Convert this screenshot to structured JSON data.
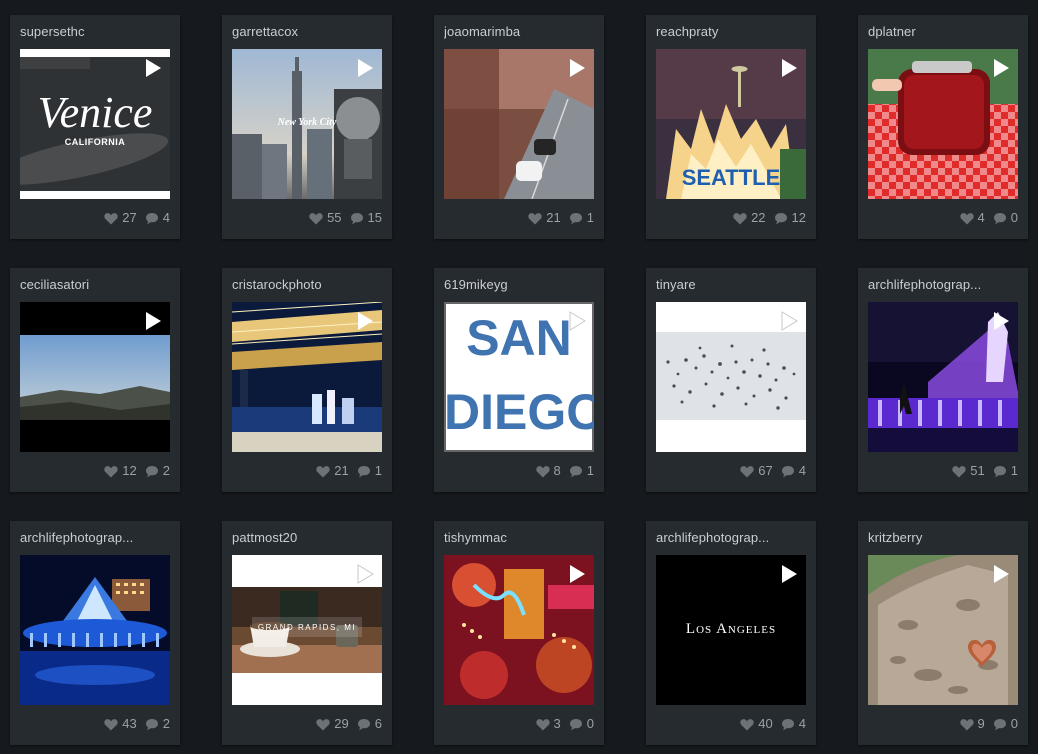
{
  "colors": {
    "background": "#16191d",
    "card": "#262b30",
    "username": "#c9ced3",
    "stats": "#9aa0a6"
  },
  "icons": {
    "play": "play-icon",
    "like": "heart-icon",
    "comment": "comment-icon"
  },
  "posts": [
    {
      "username": "supersethc",
      "likes": "27",
      "comments": "4",
      "thumb_title": "Venice",
      "thumb_subtitle": "CALIFORNIA"
    },
    {
      "username": "garrettacox",
      "likes": "55",
      "comments": "15",
      "thumb_title": "New York City"
    },
    {
      "username": "joaomarimba",
      "likes": "21",
      "comments": "1"
    },
    {
      "username": "reachpraty",
      "likes": "22",
      "comments": "12",
      "thumb_title": "SEATTLE"
    },
    {
      "username": "dplatner",
      "likes": "4",
      "comments": "0"
    },
    {
      "username": "ceciliasatori",
      "likes": "12",
      "comments": "2"
    },
    {
      "username": "cristarockphoto",
      "likes": "21",
      "comments": "1"
    },
    {
      "username": "619mikeyg",
      "likes": "8",
      "comments": "1",
      "thumb_title": "SAN",
      "thumb_subtitle": "DIEGO"
    },
    {
      "username": "tinyare",
      "likes": "67",
      "comments": "4"
    },
    {
      "username": "archlifephotograp...",
      "likes": "51",
      "comments": "1"
    },
    {
      "username": "archlifephotograp...",
      "likes": "43",
      "comments": "2"
    },
    {
      "username": "pattmost20",
      "likes": "29",
      "comments": "6",
      "thumb_title": "GRAND RAPIDS, MI"
    },
    {
      "username": "tishymmac",
      "likes": "3",
      "comments": "0"
    },
    {
      "username": "archlifephotograp...",
      "likes": "40",
      "comments": "4",
      "thumb_title": "Los Angeles"
    },
    {
      "username": "kritzberry",
      "likes": "9",
      "comments": "0"
    }
  ]
}
